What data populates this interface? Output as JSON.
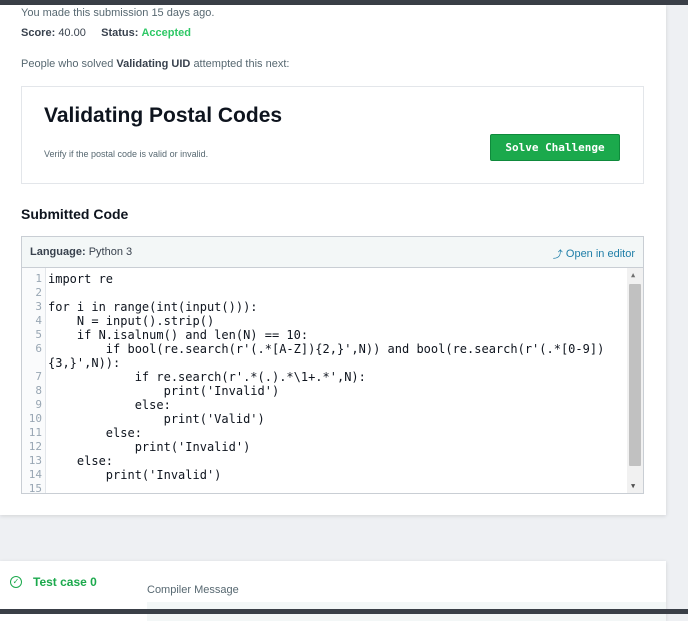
{
  "submission": {
    "made_text": "You made this submission 15 days ago.",
    "score_label": "Score:",
    "score_value": "40.00",
    "status_label": "Status:",
    "status_value": "Accepted"
  },
  "next": {
    "prefix": "People who solved",
    "challenge_name": "Validating UID",
    "suffix": "attempted this next:"
  },
  "challenge": {
    "title": "Validating Postal Codes",
    "description": "Verify if the postal code is valid or invalid.",
    "button_label": "Solve Challenge"
  },
  "submitted_code": {
    "heading": "Submitted Code",
    "language_label": "Language:",
    "language_value": "Python 3",
    "open_editor": "Open in editor"
  },
  "code_lines": [
    "import re",
    "",
    "for i in range(int(input())):",
    "    N = input().strip()",
    "    if N.isalnum() and len(N) == 10:",
    "        if bool(re.search(r'(.*[A-Z]){2,}',N)) and bool(re.search(r'(.*[0-9])",
    "{3,}',N)):",
    "            if re.search(r'.*(.).*\\1+.*',N):",
    "                print('Invalid')",
    "            else:",
    "                print('Valid')",
    "        else:",
    "            print('Invalid')",
    "    else:",
    "        print('Invalid')"
  ],
  "line_numbers": [
    "1",
    "2",
    "3",
    "4",
    "5",
    "6",
    "",
    "7",
    "8",
    "9",
    "10",
    "11",
    "12",
    "13",
    "14",
    "15"
  ],
  "testcase": {
    "label": "Test case 0",
    "compiler_message": "Compiler Message"
  },
  "icons": {
    "external": "external-link-icon",
    "check": "check-circle-icon"
  },
  "colors": {
    "accent_green": "#1ba94c",
    "accepted_green": "#2ec866",
    "link_blue": "#1f7ea8"
  }
}
